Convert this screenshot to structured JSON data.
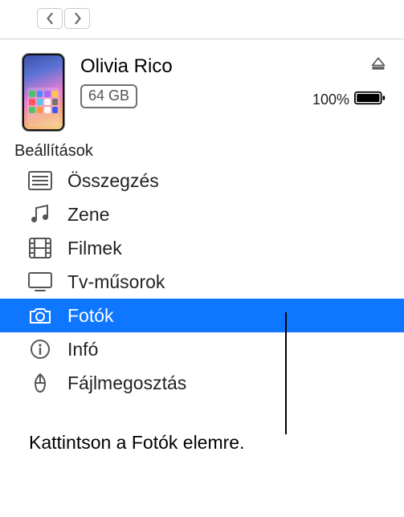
{
  "device": {
    "name": "Olivia Rico",
    "storage": "64 GB",
    "battery_pct": "100%"
  },
  "sidebar": {
    "sectionLabel": "Beállítások",
    "items": [
      {
        "label": "Összegzés"
      },
      {
        "label": "Zene"
      },
      {
        "label": "Filmek"
      },
      {
        "label": "Tv-műsorok"
      },
      {
        "label": "Fotók"
      },
      {
        "label": "Infó"
      },
      {
        "label": "Fájlmegosztás"
      }
    ]
  },
  "caption": "Kattintson a Fotók elemre."
}
